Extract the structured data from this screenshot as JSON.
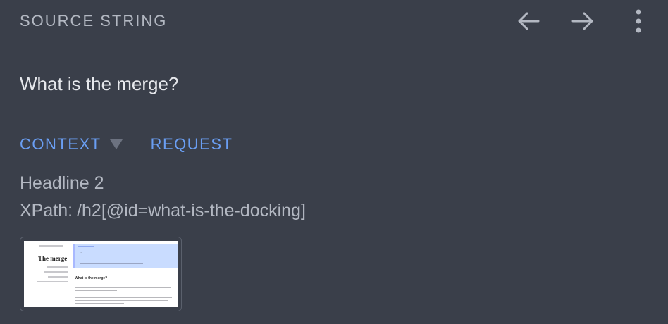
{
  "header": {
    "label": "SOURCE STRING",
    "prev_icon": "arrow-left-icon",
    "next_icon": "arrow-right-icon",
    "menu_icon": "more-vertical-icon"
  },
  "source": {
    "text": "What is the merge?"
  },
  "tabs": [
    {
      "label": "CONTEXT",
      "active": true
    },
    {
      "label": "REQUEST",
      "active": false
    }
  ],
  "context": {
    "type": "Headline 2",
    "xpath_label": "XPath:",
    "xpath_value": "/h2[@id=what-is-the-docking]"
  },
  "thumbnail": {
    "page_title": "The merge",
    "banner_title": "...",
    "section_heading": "What is the merge?"
  },
  "colors": {
    "background": "#3a3f4a",
    "label": "#b3b8c2",
    "text": "#e6e8ec",
    "accent": "#6a9ef2"
  }
}
